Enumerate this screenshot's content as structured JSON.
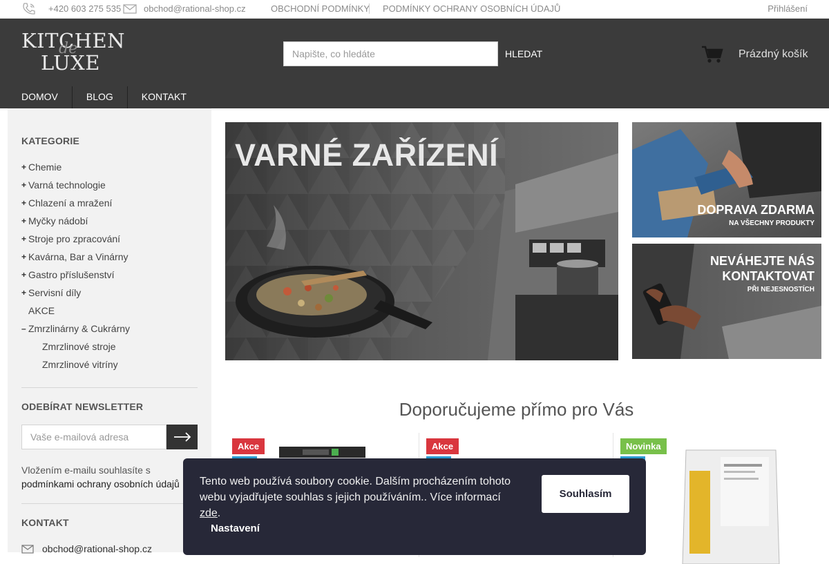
{
  "topbar": {
    "phone": "+420 603 275 535",
    "email": "obchod@rational-shop.cz",
    "links": [
      "OBCHODNÍ PODMÍNKY",
      "PODMÍNKY OCHRANY OSOBNÍCH ÚDAJŮ"
    ],
    "login": "Přihlášení"
  },
  "header": {
    "logo": {
      "line1": "KITCHEN",
      "mid": "de",
      "line2": "LUXE"
    },
    "search": {
      "placeholder": "Napište, co hledáte",
      "button": "HLEDAT"
    },
    "cart": "Prázdný košík",
    "nav": [
      "DOMOV",
      "BLOG",
      "KONTAKT"
    ]
  },
  "sidebar": {
    "categories_title": "KATEGORIE",
    "categories": [
      {
        "label": "Chemie",
        "toggle": "+"
      },
      {
        "label": "Varná technologie",
        "toggle": "+"
      },
      {
        "label": "Chlazení a mražení",
        "toggle": "+"
      },
      {
        "label": "Myčky nádobí",
        "toggle": "+"
      },
      {
        "label": "Stroje pro zpracování",
        "toggle": "+"
      },
      {
        "label": "Kavárna, Bar a Vinárny",
        "toggle": "+"
      },
      {
        "label": "Gastro příslušenství",
        "toggle": "+"
      },
      {
        "label": "Servisní díly",
        "toggle": "+"
      },
      {
        "label": "AKCE",
        "toggle": ""
      },
      {
        "label": "Zmrzlinárny & Cukrárny",
        "toggle": "–"
      }
    ],
    "subcategories": [
      "Zmrzlinové stroje",
      "Zmrzlinové vitríny"
    ],
    "newsletter_title": "ODEBÍRAT NEWSLETTER",
    "newsletter_placeholder": "Vaše e-mailová adresa",
    "newsletter_text": "Vložením e-mailu souhlasíte s",
    "newsletter_link": "podmínkami ochrany osobních údajů",
    "contact_title": "KONTAKT",
    "contact_email": "obchod@rational-shop.cz"
  },
  "banners": {
    "main": {
      "title": "VARNÉ ZAŘÍZENÍ"
    },
    "side1": {
      "title": "DOPRAVA ZDARMA",
      "subtitle": "NA VŠECHNY PRODUKTY"
    },
    "side2": {
      "title_line1": "NEVÁHEJTE NÁS",
      "title_line2": "KONTAKTOVAT",
      "subtitle": "PŘI NEJESNOSTÍCH"
    }
  },
  "recommended": {
    "title": "Doporučujeme přímo pro Vás",
    "products": [
      {
        "badge": "Akce"
      },
      {
        "badge": "Akce"
      },
      {
        "badge": "Novinka"
      }
    ]
  },
  "cookie": {
    "text": "Tento web používá soubory cookie. Dalším procházením tohoto webu vyjadřujete souhlas s jejich používáním.. Více informací ",
    "link": "zde",
    "after": ".",
    "accept": "Souhlasím",
    "settings": "Nastavení"
  },
  "colors": {
    "header_bg": "#3b3b3b",
    "sidebar_bg": "#f2f2f2",
    "badge_akce": "#d9363e",
    "badge_novinka": "#78c04a",
    "cookie_bg": "#272838"
  }
}
